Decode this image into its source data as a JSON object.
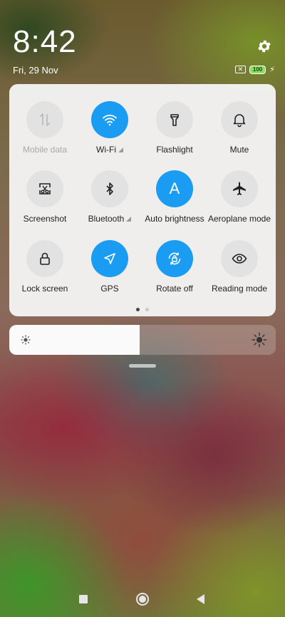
{
  "status": {
    "time": "8:42",
    "date": "Fri, 29 Nov",
    "sim_label": "✕",
    "battery_level": "100",
    "charging_icon": "bolt-icon",
    "settings_icon": "gear-icon"
  },
  "quick_settings": {
    "accent_color": "#1a9cf2",
    "tiles": [
      {
        "label": "Mobile data",
        "icon": "mobile-data-icon",
        "active": false,
        "disabled": true
      },
      {
        "label": "Wi-Fi",
        "icon": "wifi-icon",
        "active": true
      },
      {
        "label": "Flashlight",
        "icon": "flashlight-icon",
        "active": false
      },
      {
        "label": "Mute",
        "icon": "bell-icon",
        "active": false
      },
      {
        "label": "Screenshot",
        "icon": "screenshot-icon",
        "active": false
      },
      {
        "label": "Bluetooth",
        "icon": "bluetooth-icon",
        "active": false
      },
      {
        "label": "Auto brightness",
        "icon": "auto-brightness-icon",
        "active": true
      },
      {
        "label": "Aeroplane mode",
        "icon": "airplane-icon",
        "active": false
      },
      {
        "label": "Lock screen",
        "icon": "lock-icon",
        "active": false
      },
      {
        "label": "GPS",
        "icon": "location-arrow-icon",
        "active": true
      },
      {
        "label": "Rotate off",
        "icon": "rotation-lock-icon",
        "active": true
      },
      {
        "label": "Reading mode",
        "icon": "eye-icon",
        "active": false
      }
    ],
    "auto_brightness_glyph": "A",
    "page_count": 2,
    "current_page": 1
  },
  "brightness": {
    "level_fraction": 0.49
  },
  "navigation": {
    "recents_icon": "square-icon",
    "home_icon": "circle-icon",
    "back_icon": "triangle-back-icon"
  }
}
